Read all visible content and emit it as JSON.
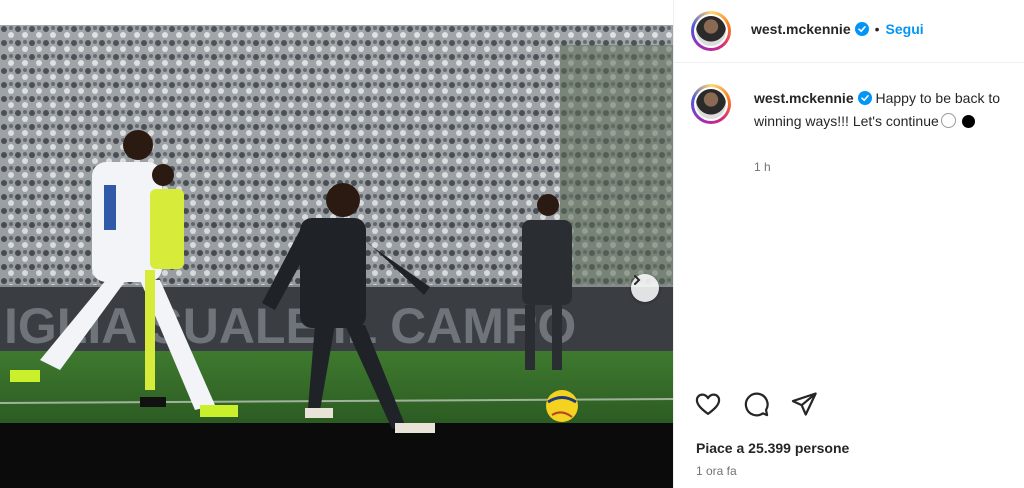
{
  "post": {
    "username": "west.mckennie",
    "separator": "•",
    "follow_label": "Segui",
    "caption_text": "Happy to be back to winning ways!!! Let's continue",
    "caption_emojis": [
      "white-circle",
      "black-circle"
    ],
    "relative_time": "1 h",
    "likes_text": "Piace a 25.399 persone",
    "posted_time": "1 ora fa"
  },
  "media": {
    "banner_text": "IGLIA     SUALE  IL  CAMPO",
    "carousel_dot_count": 2,
    "carousel_active_index": 0
  },
  "icons": {
    "like": "heart-icon",
    "comment": "comment-icon",
    "share": "send-icon",
    "next": "chevron-right-icon",
    "verified": "verified-badge-icon"
  },
  "colors": {
    "follow": "#0095f6",
    "text": "#262626",
    "secondary": "#737373",
    "verified": "#0095f6"
  }
}
